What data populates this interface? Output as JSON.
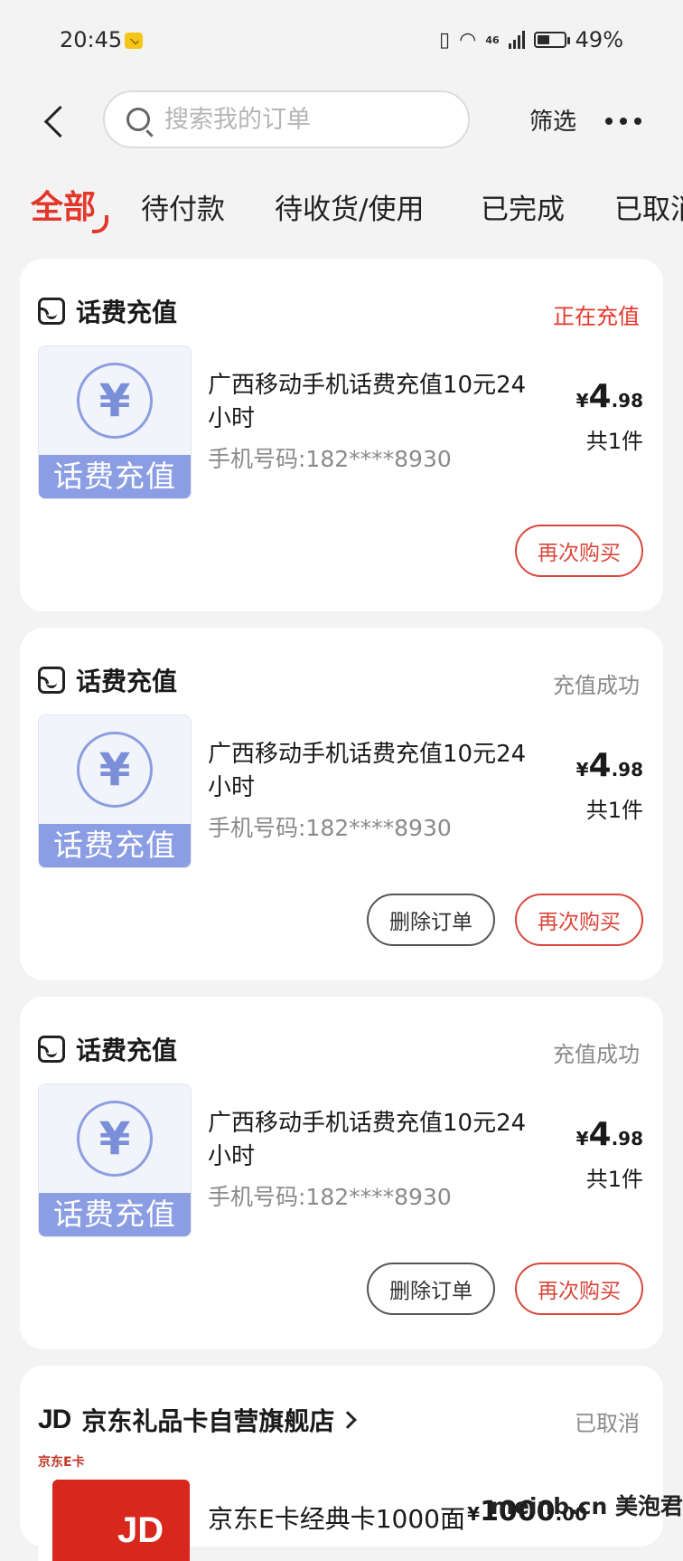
{
  "status_bar": {
    "time": "20:45",
    "network": "46",
    "battery": "49%"
  },
  "header": {
    "search_placeholder": "搜索我的订单",
    "filter_label": "筛选"
  },
  "tabs": [
    {
      "label": "全部",
      "active": true
    },
    {
      "label": "待付款",
      "active": false
    },
    {
      "label": "待收货/使用",
      "active": false
    },
    {
      "label": "已完成",
      "active": false
    },
    {
      "label": "已取消",
      "active": false
    }
  ],
  "orders": [
    {
      "shop": "话费充值",
      "status": "正在充值",
      "thumb_label": "话费充值",
      "title": "广西移动手机话费充值10元24小时",
      "phone": "手机号码:182****8930",
      "price_symbol": "¥",
      "price_int": "4",
      "price_dec": ".98",
      "quantity": "共1件",
      "buttons": {
        "rebuy": "再次购买"
      }
    },
    {
      "shop": "话费充值",
      "status": "充值成功",
      "thumb_label": "话费充值",
      "title": "广西移动手机话费充值10元24小时",
      "phone": "手机号码:182****8930",
      "price_symbol": "¥",
      "price_int": "4",
      "price_dec": ".98",
      "quantity": "共1件",
      "buttons": {
        "delete": "删除订单",
        "rebuy": "再次购买"
      }
    },
    {
      "shop": "话费充值",
      "status": "充值成功",
      "thumb_label": "话费充值",
      "title": "广西移动手机话费充值10元24小时",
      "phone": "手机号码:182****8930",
      "price_symbol": "¥",
      "price_int": "4",
      "price_dec": ".98",
      "quantity": "共1件",
      "buttons": {
        "delete": "删除订单",
        "rebuy": "再次购买"
      }
    }
  ],
  "jd_order": {
    "logo": "JD",
    "shop": "京东礼品卡自营旗舰店",
    "status": "已取消",
    "thumb_label": "京东E卡",
    "title": "京东E卡经典卡1000面",
    "price_symbol": "¥",
    "price_int": "1000",
    "price_dec": ".00"
  },
  "watermark": "meinb.cn 美泡君",
  "colors": {
    "accent": "#e4372c",
    "coin": "#8c9ee3"
  }
}
